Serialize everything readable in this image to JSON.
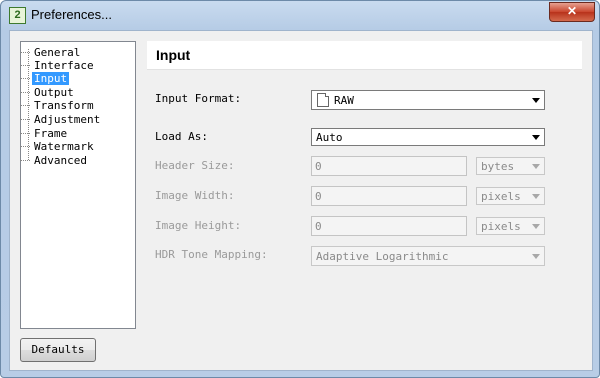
{
  "window": {
    "title": "Preferences...",
    "icon_glyph": "2",
    "close_glyph": "✕"
  },
  "tree": {
    "items": [
      {
        "label": "General"
      },
      {
        "label": "Interface"
      },
      {
        "label": "Input",
        "selected": true
      },
      {
        "label": "Output"
      },
      {
        "label": "Transform"
      },
      {
        "label": "Adjustment"
      },
      {
        "label": "Frame"
      },
      {
        "label": "Watermark"
      },
      {
        "label": "Advanced"
      }
    ]
  },
  "panel": {
    "title": "Input"
  },
  "form": {
    "input_format": {
      "label": "Input Format:",
      "value": "RAW",
      "icon": "file-icon"
    },
    "load_as": {
      "label": "Load As:",
      "value": "Auto"
    },
    "header_size": {
      "label": "Header Size:",
      "value": "0",
      "unit": "bytes"
    },
    "image_width": {
      "label": "Image Width:",
      "value": "0",
      "unit": "pixels"
    },
    "image_height": {
      "label": "Image Height:",
      "value": "0",
      "unit": "pixels"
    },
    "hdr_tone_mapping": {
      "label": "HDR Tone Mapping:",
      "value": "Adaptive Logarithmic"
    }
  },
  "buttons": {
    "defaults": "Defaults"
  },
  "colors": {
    "selection": "#3399ff",
    "title_bar": "#b9cfe8",
    "close_button": "#c9452c"
  }
}
